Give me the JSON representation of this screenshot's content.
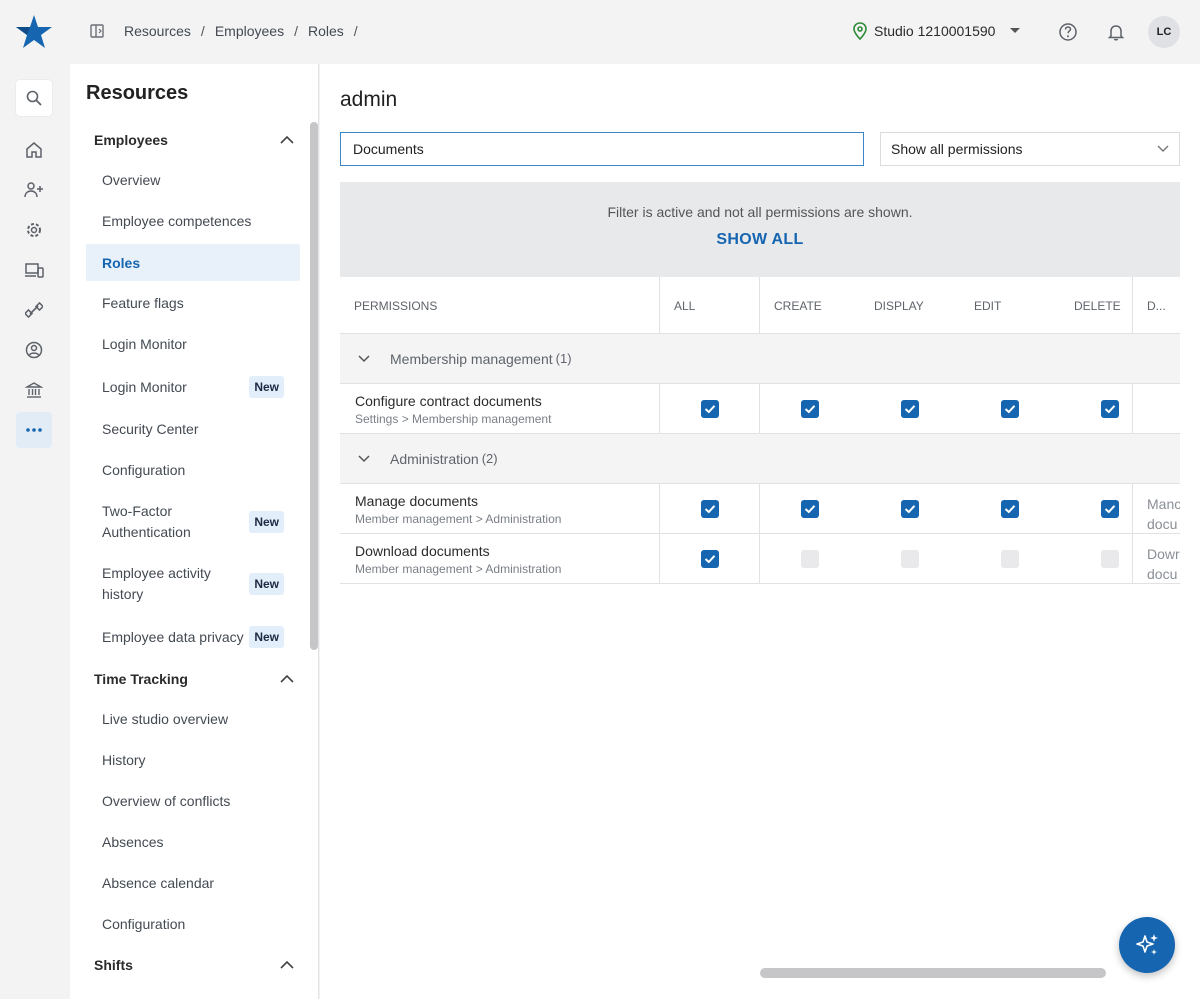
{
  "breadcrumb": [
    "Resources",
    "Employees",
    "Roles"
  ],
  "studio": {
    "label": "Studio 1210001590"
  },
  "avatar": {
    "initials": "LC"
  },
  "sidebar": {
    "title": "Resources",
    "sections": {
      "employees": "Employees",
      "time_tracking": "Time Tracking",
      "shifts": "Shifts"
    },
    "employees_items": [
      {
        "label": "Overview"
      },
      {
        "label": "Employee competences"
      },
      {
        "label": "Roles",
        "active": true
      },
      {
        "label": "Feature flags"
      },
      {
        "label": "Login Monitor"
      },
      {
        "label": "Login Monitor",
        "badge": "New"
      },
      {
        "label": "Security Center"
      },
      {
        "label": "Configuration"
      },
      {
        "label": "Two-Factor Authentication",
        "badge": "New"
      },
      {
        "label": "Employee activity history",
        "badge": "New"
      },
      {
        "label": "Employee data privacy",
        "badge": "New"
      }
    ],
    "time_tracking_items": [
      {
        "label": "Live studio overview"
      },
      {
        "label": "History"
      },
      {
        "label": "Overview of conflicts"
      },
      {
        "label": "Absences"
      },
      {
        "label": "Absence calendar"
      },
      {
        "label": "Configuration"
      }
    ]
  },
  "main": {
    "role_title": "admin",
    "search": {
      "value": "Documents"
    },
    "filter_select": {
      "value": "Show all permissions"
    },
    "banner": {
      "message": "Filter is active and not all permissions are shown.",
      "action": "SHOW ALL"
    },
    "columns": {
      "permissions": "PERMISSIONS",
      "all": "ALL",
      "create": "CREATE",
      "display": "DISPLAY",
      "edit": "EDIT",
      "delete": "DELETE",
      "description": "D..."
    },
    "groups": [
      {
        "name": "Membership management",
        "count": "(1)",
        "rows": [
          {
            "name": "Configure contract documents",
            "path": "Settings > Membership management",
            "checks": [
              true,
              true,
              true,
              true,
              true
            ],
            "enabled": [
              true,
              true,
              true,
              true,
              true
            ],
            "desc": ""
          }
        ]
      },
      {
        "name": "Administration",
        "count": "(2)",
        "rows": [
          {
            "name": "Manage documents",
            "path": "Member management > Administration",
            "checks": [
              true,
              true,
              true,
              true,
              true
            ],
            "enabled": [
              true,
              true,
              true,
              true,
              true
            ],
            "desc": [
              "Manc",
              "docu"
            ]
          },
          {
            "name": "Download documents",
            "path": "Member management > Administration",
            "checks": [
              true,
              false,
              false,
              false,
              false
            ],
            "enabled": [
              true,
              false,
              false,
              false,
              false
            ],
            "desc": [
              "Dowr",
              "docu"
            ]
          }
        ]
      }
    ]
  },
  "colors": {
    "accent": "#1565b0",
    "badge_bg": "#e3eefb",
    "banner_bg": "#e8e9eb"
  }
}
